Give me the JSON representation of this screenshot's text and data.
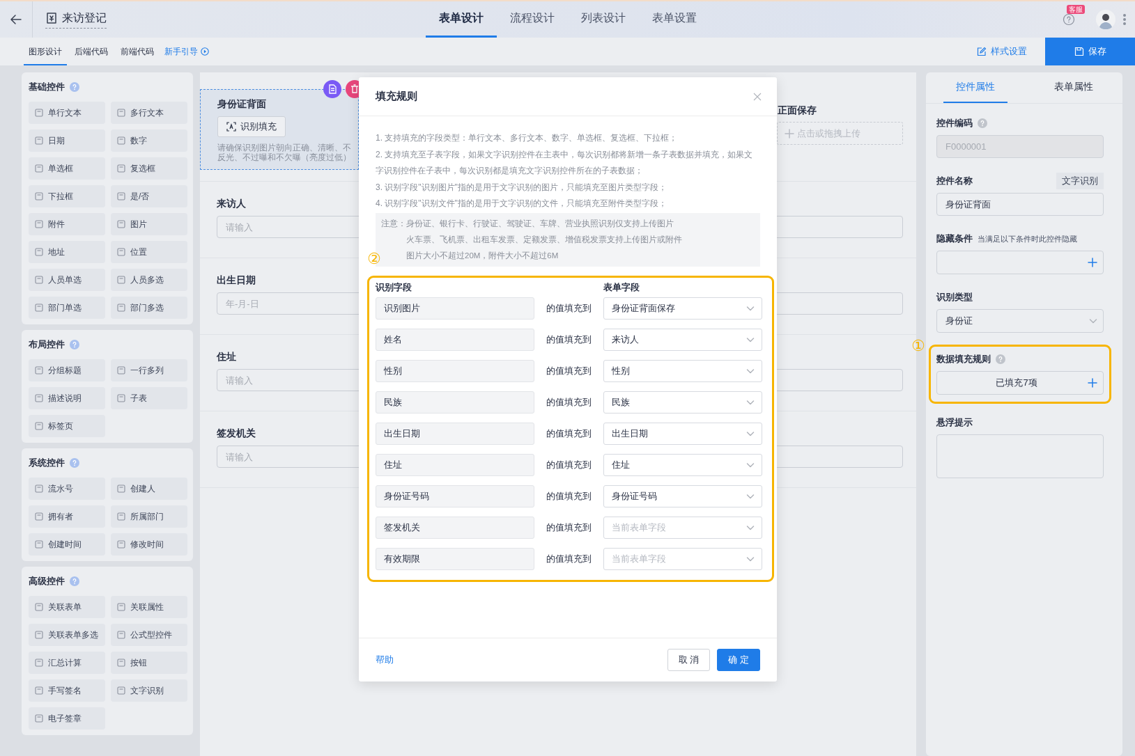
{
  "top_bar": {
    "title": "来访登记",
    "tabs": [
      {
        "label": "表单设计",
        "selected": true
      },
      {
        "label": "流程设计",
        "selected": false
      },
      {
        "label": "列表设计",
        "selected": false
      },
      {
        "label": "表单设置",
        "selected": false
      }
    ],
    "help_badge": "客服"
  },
  "sub_bar": {
    "tabs": [
      {
        "label": "图形设计",
        "selected": true
      },
      {
        "label": "后端代码",
        "selected": false
      },
      {
        "label": "前端代码",
        "selected": false
      }
    ],
    "guide_link": "新手引导",
    "style_button": "样式设置",
    "save_button": "保存"
  },
  "palette": {
    "sections": [
      {
        "title": "基础控件",
        "items": [
          "单行文本",
          "多行文本",
          "日期",
          "数字",
          "单选框",
          "复选框",
          "下拉框",
          "是/否",
          "附件",
          "图片",
          "地址",
          "位置",
          "人员单选",
          "人员多选",
          "部门单选",
          "部门多选"
        ]
      },
      {
        "title": "布局控件",
        "items": [
          "分组标题",
          "一行多列",
          "描述说明",
          "子表",
          "标签页"
        ]
      },
      {
        "title": "系统控件",
        "items": [
          "流水号",
          "创建人",
          "拥有者",
          "所属部门",
          "创建时间",
          "修改时间"
        ]
      },
      {
        "title": "高级控件",
        "items": [
          "关联表单",
          "关联属性",
          "关联表单多选",
          "公式型控件",
          "汇总计算",
          "按钮",
          "手写签名",
          "文字识别",
          "电子签章"
        ]
      }
    ]
  },
  "canvas": {
    "fields": [
      {
        "kind": "ocr",
        "label": "身份证背面",
        "button": "识别填充",
        "hint": "请确保识别图片朝向正确、清晰、不反光、不过曝和不欠曝（亮度过低）",
        "selected": true
      },
      {
        "kind": "upload",
        "label": "正面保存",
        "placeholder": "点击或拖拽上传",
        "selected": false
      },
      {
        "kind": "input",
        "label": "来访人",
        "placeholder": "请输入",
        "selected": false
      },
      {
        "kind": "input",
        "label": "出生日期",
        "placeholder": "年-月-日",
        "selected": false
      },
      {
        "kind": "input",
        "label": "住址",
        "placeholder": "请输入",
        "selected": false
      },
      {
        "kind": "input",
        "label": "签发机关",
        "placeholder": "请输入",
        "selected": false
      }
    ]
  },
  "modal": {
    "title": "填充规则",
    "notes": [
      "1. 支持填充的字段类型：单行文本、多行文本、数字、单选框、复选框、下拉框；",
      "2. 支持填充至子表字段，如果文字识别控件在主表中，每次识别都将新增一条子表数据并填充，如果文字识别控件在子表中，每次识别都是填充文字识别控件所在的子表数据；",
      "3. 识别字段\"识别图片\"指的是用于文字识别的图片，只能填充至图片类型字段；",
      "4. 识别字段\"识别文件\"指的是用于文字识别的文件，只能填充至附件类型字段；"
    ],
    "notice": {
      "label": "注意：",
      "lines": [
        "身份证、银行卡、行驶证、驾驶证、车牌、营业执照识别仅支持上传图片",
        "火车票、飞机票、出租车发票、定额发票、增值税发票支持上传图片或附件",
        "图片大小不超过20M，附件大小不超过6M"
      ]
    },
    "annotation": "②",
    "columns": [
      "识别字段",
      "表单字段"
    ],
    "rows": [
      {
        "source": "识别图片",
        "connector": "的值填充到",
        "value": "身份证背面保存"
      },
      {
        "source": "姓名",
        "connector": "的值填充到",
        "value": "来访人"
      },
      {
        "source": "性别",
        "connector": "的值填充到",
        "value": "性别"
      },
      {
        "source": "民族",
        "connector": "的值填充到",
        "value": "民族"
      },
      {
        "source": "出生日期",
        "connector": "的值填充到",
        "value": "出生日期"
      },
      {
        "source": "住址",
        "connector": "的值填充到",
        "value": "住址"
      },
      {
        "source": "身份证号码",
        "connector": "的值填充到",
        "value": "身份证号码"
      },
      {
        "source": "签发机关",
        "connector": "的值填充到",
        "placeholder": "当前表单字段"
      },
      {
        "source": "有效期限",
        "connector": "的值填充到",
        "placeholder": "当前表单字段"
      }
    ],
    "help_link": "帮助",
    "buttons": [
      {
        "label": "取 消",
        "kind": "default"
      },
      {
        "label": "确 定",
        "kind": "primary"
      }
    ]
  },
  "properties": {
    "tabs": [
      {
        "label": "控件属性",
        "selected": true
      },
      {
        "label": "表单属性",
        "selected": false
      }
    ],
    "fields": [
      {
        "kind": "input",
        "label": "控件编码",
        "help": true,
        "value": "F0000001",
        "disabled": true
      },
      {
        "kind": "input",
        "label": "控件名称",
        "tag": "文字识别",
        "value": "身份证背面",
        "disabled": false
      },
      {
        "kind": "condition",
        "label": "隐藏条件",
        "note": "当满足以下条件时此控件隐藏"
      },
      {
        "kind": "select",
        "label": "识别类型",
        "value": "身份证"
      },
      {
        "kind": "rule",
        "label": "数据填充规则",
        "help": true,
        "value": "已填充7项",
        "highlighted": true,
        "annotation": "①"
      },
      {
        "kind": "textarea",
        "label": "悬浮提示"
      }
    ]
  }
}
